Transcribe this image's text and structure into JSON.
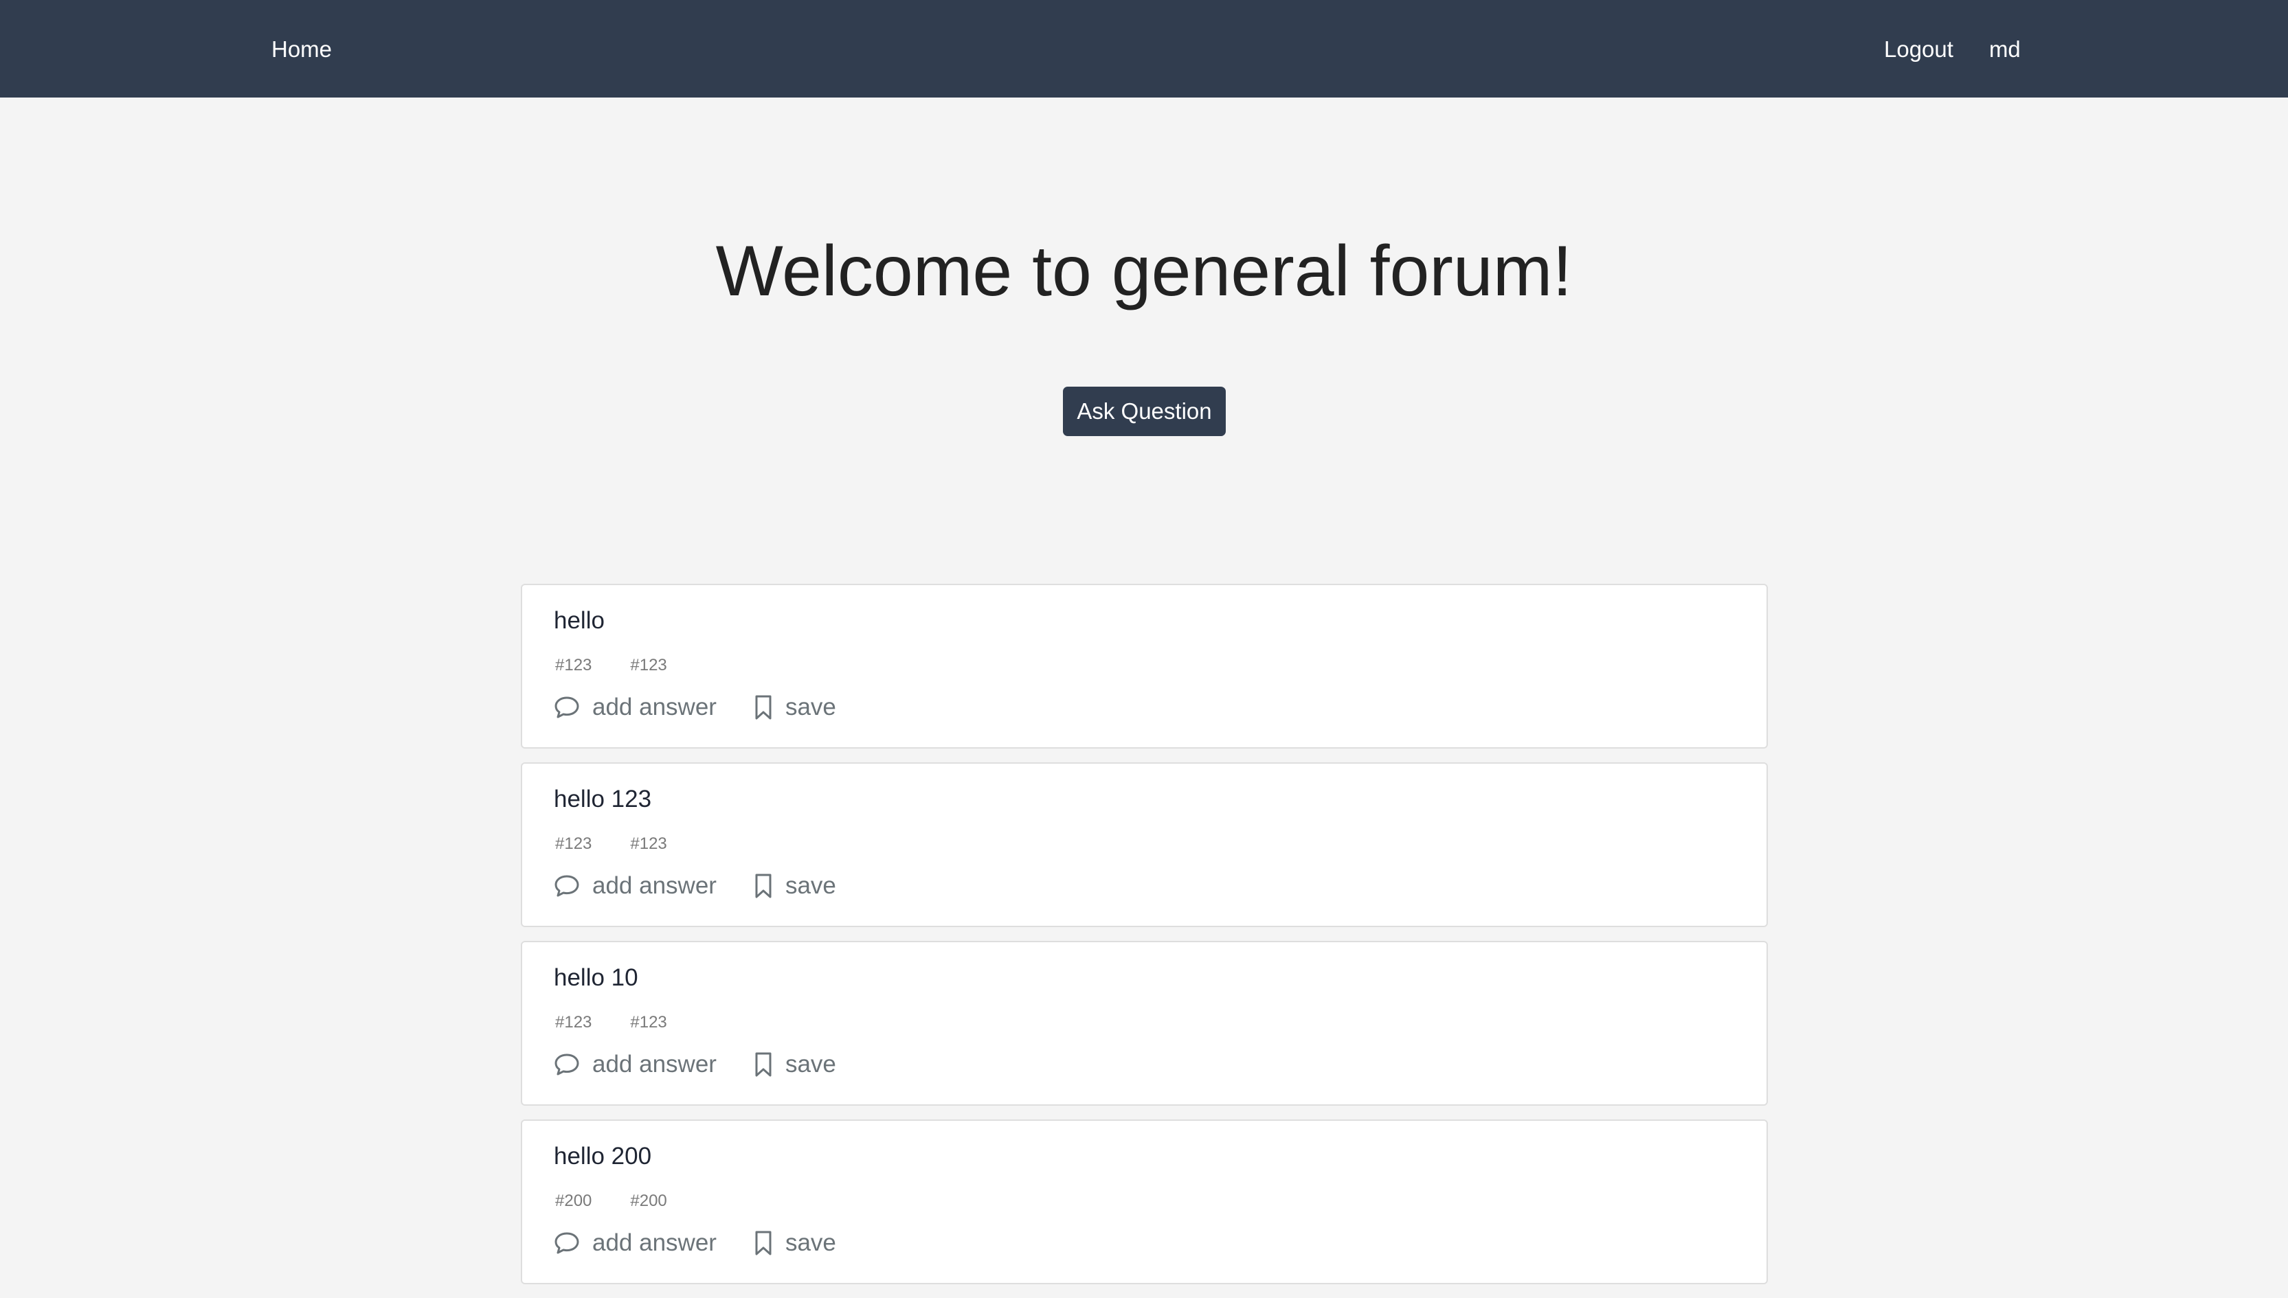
{
  "nav": {
    "home": "Home",
    "logout": "Logout",
    "user": "md"
  },
  "hero": {
    "title": "Welcome to general forum!",
    "ask_button": "Ask Question"
  },
  "questions": [
    {
      "title": "hello",
      "tags": [
        "#123",
        "#123"
      ],
      "answer_label": "add answer",
      "save_label": "save"
    },
    {
      "title": "hello 123",
      "tags": [
        "#123",
        "#123"
      ],
      "answer_label": "add answer",
      "save_label": "save"
    },
    {
      "title": "hello 10",
      "tags": [
        "#123",
        "#123"
      ],
      "answer_label": "add answer",
      "save_label": "save"
    },
    {
      "title": "hello 200",
      "tags": [
        "#200",
        "#200"
      ],
      "answer_label": "add answer",
      "save_label": "save"
    }
  ],
  "icons": {
    "answer": "comment-icon",
    "save": "bookmark-icon"
  },
  "colors": {
    "navbar": "#313d4f",
    "background": "#f4f4f4",
    "button": "#313d4f",
    "action_text": "#6b7378"
  }
}
